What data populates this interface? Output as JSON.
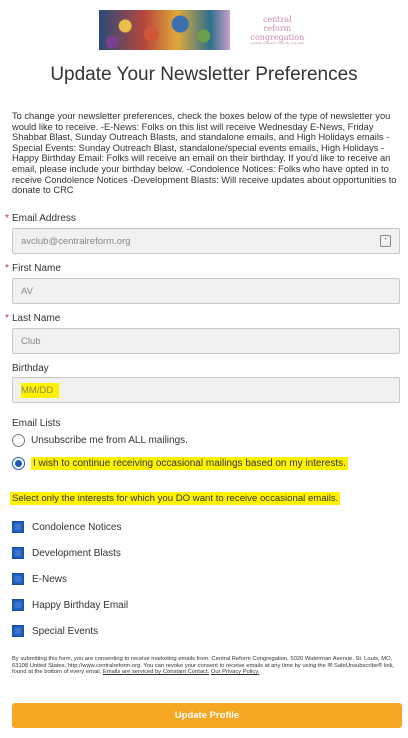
{
  "logo": {
    "line1": "central",
    "line2": "reform",
    "line3": "congregation",
    "tagline": "a jewish community of the city of st. louis"
  },
  "title": "Update Your Newsletter Preferences",
  "intro": "To change your newsletter preferences, check the boxes below of the type of newsletter you would like to receive. -E-News: Folks on this list will receive Wednesday E-News, Friday Shabbat Blast, Sunday Outreach Blasts, and standalone emails, and High Holidays emails -Special Events: Sunday Outreach Blast, standalone/special events emails, High Holidays -Happy Birthday Email: Folks will receive an email on their birthday. If you'd like to receive an email, please include your birthday below. -Condolence Notices: Folks who have opted in to receive Condolence Notices -Development Blasts: Will receive updates about opportunities to donate to CRC",
  "fields": {
    "email": {
      "label": "Email Address",
      "value": "avclub@centralreform.org",
      "required": true
    },
    "first_name": {
      "label": "First Name",
      "value": "AV",
      "required": true
    },
    "last_name": {
      "label": "Last Name",
      "value": "Club",
      "required": true
    },
    "birthday": {
      "label": "Birthday",
      "placeholder": "MM/DD",
      "value": ""
    }
  },
  "email_lists": {
    "label": "Email Lists",
    "options": [
      {
        "label": "Unsubscribe me from ALL mailings.",
        "selected": false
      },
      {
        "label": "I wish to continue receiving occasional mailings based on my interests.",
        "selected": true
      }
    ]
  },
  "interests_prompt": "Select only the interests for which you DO want to receive occasional emails.",
  "interests": [
    {
      "label": "Condolence Notices",
      "checked": true
    },
    {
      "label": "Development Blasts",
      "checked": true
    },
    {
      "label": "E-News",
      "checked": true
    },
    {
      "label": "Happy Birthday Email",
      "checked": true
    },
    {
      "label": "Special Events",
      "checked": true
    }
  ],
  "legal": {
    "text": "By submitting this form, you are consenting to receive marketing emails from: Central Reform Congregation, 5020 Waterman Avenue, St. Louis, MO, 63108 United States, http://www.centralreform.org. You can revoke your consent to receive emails at any time by using the ✉ SafeUnsubscribe® link, found at the bottom of every email.",
    "link1": "Emails are serviced by Constant Contact.",
    "link2": "Our Privacy Policy."
  },
  "submit_label": "Update Profile",
  "colors": {
    "accent": "#f5a623",
    "checkbox": "#1f5fbf",
    "highlight": "#fff200",
    "required": "#c62828"
  }
}
